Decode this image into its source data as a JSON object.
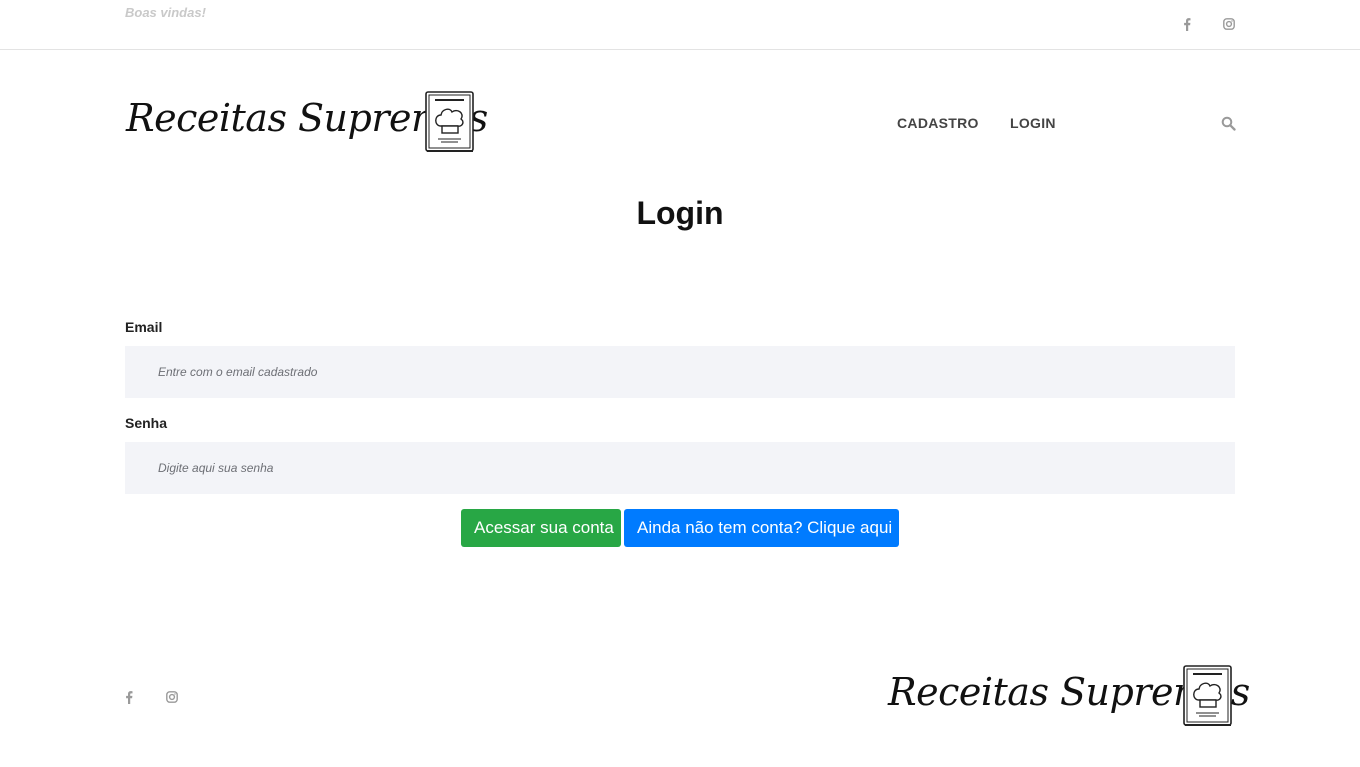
{
  "topbar": {
    "welcome": "Boas vindas!",
    "social": [
      {
        "icon": "facebook-icon"
      },
      {
        "icon": "instagram-icon"
      }
    ]
  },
  "header": {
    "logo_text": "Receitas Supremas",
    "nav": [
      {
        "label": "CADASTRO"
      },
      {
        "label": "LOGIN"
      }
    ],
    "search_icon": "search-icon"
  },
  "main": {
    "title": "Login",
    "email": {
      "label": "Email",
      "placeholder": "Entre com o email cadastrado",
      "value": ""
    },
    "password": {
      "label": "Senha",
      "placeholder": "Digite aqui sua senha",
      "value": ""
    },
    "login_button": "Acessar sua conta",
    "signup_button": "Ainda não tem conta? Clique aqui"
  },
  "footer": {
    "logo_text": "Receitas Supremas",
    "social": [
      {
        "icon": "facebook-icon"
      },
      {
        "icon": "instagram-icon"
      }
    ]
  },
  "colors": {
    "login_button": "#28a745",
    "signup_button": "#007bff",
    "input_background": "#f3f4f8",
    "icon_gray": "#9a9a9a"
  }
}
